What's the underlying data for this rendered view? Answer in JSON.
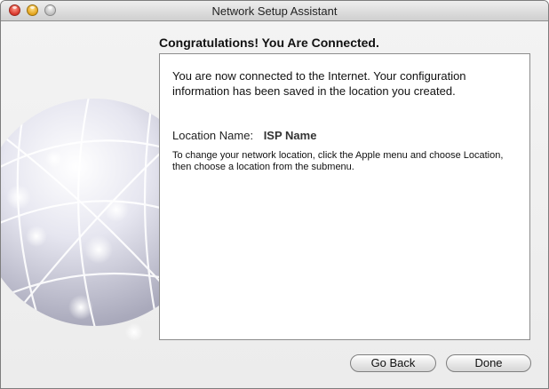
{
  "window": {
    "title": "Network Setup Assistant"
  },
  "main": {
    "heading": "Congratulations! You Are Connected.",
    "intro": "You are now connected to the Internet. Your configuration information has been saved in the location you created.",
    "location_label": "Location Name:",
    "location_value": "ISP Name",
    "help": "To change your network location, click the Apple menu and choose Location, then choose a location from the submenu."
  },
  "buttons": {
    "back": "Go Back",
    "done": "Done"
  }
}
